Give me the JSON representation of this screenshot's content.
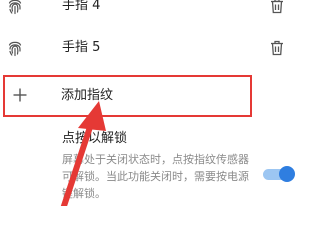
{
  "fingerprints": [
    {
      "label": "手指 4",
      "icon": "fingerprint-icon",
      "action_icon": "trash-icon"
    },
    {
      "label": "手指 5",
      "icon": "fingerprint-icon",
      "action_icon": "trash-icon"
    }
  ],
  "add_fingerprint": {
    "label": "添加指纹",
    "icon": "plus-icon"
  },
  "press_unlock": {
    "title": "点按以解锁",
    "description": "屏幕处于关闭状态时，点按指纹传感器可解锁。当此功能关闭时，需要按电源键解锁。",
    "enabled": true
  },
  "colors": {
    "highlight": "#e53935",
    "toggle_thumb": "#2f7ee0",
    "toggle_track": "#9cc6f2"
  }
}
